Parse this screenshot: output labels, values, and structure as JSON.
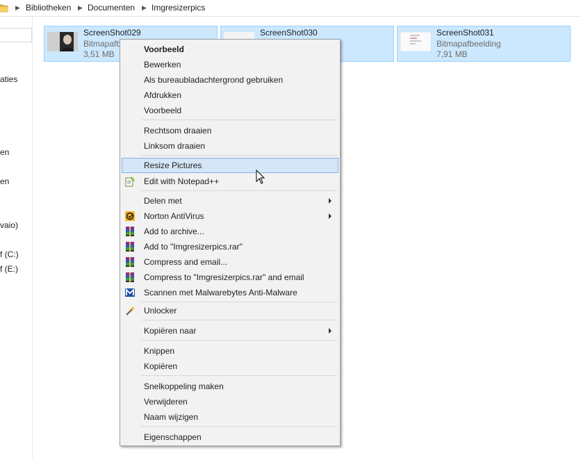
{
  "breadcrumb": {
    "items": [
      "Bibliotheken",
      "Documenten",
      "Imgresizerpics"
    ]
  },
  "navpane": {
    "items": [
      "aties",
      "en",
      "en",
      "vaio)",
      "f (C:)",
      "f (E:)"
    ]
  },
  "files": [
    {
      "name": "ScreenShot029",
      "type": "Bitmapafb",
      "size": "3,51 MB"
    },
    {
      "name": "ScreenShot030",
      "type": "",
      "size": ""
    },
    {
      "name": "ScreenShot031",
      "type": "Bitmapafbeelding",
      "size": "7,91 MB"
    }
  ],
  "context_menu": {
    "items": [
      {
        "label": "Voorbeeld",
        "bold": true
      },
      {
        "label": "Bewerken"
      },
      {
        "label": "Als bureaubladachtergrond gebruiken"
      },
      {
        "label": "Afdrukken"
      },
      {
        "label": "Voorbeeld"
      },
      {
        "label": "Rechtsom draaien"
      },
      {
        "label": "Linksom draaien"
      },
      {
        "label": "Resize Pictures",
        "highlighted": true
      },
      {
        "label": "Edit with Notepad++",
        "icon": "notepad-plus-plus-icon"
      },
      {
        "label": "Delen met",
        "submenu": true
      },
      {
        "label": "Norton AntiVirus",
        "icon": "norton-antivirus-icon",
        "submenu": true
      },
      {
        "label": "Add to archive...",
        "icon": "winrar-icon"
      },
      {
        "label": "Add to \"Imgresizerpics.rar\"",
        "icon": "winrar-icon"
      },
      {
        "label": "Compress and email...",
        "icon": "winrar-icon"
      },
      {
        "label": "Compress to \"Imgresizerpics.rar\" and email",
        "icon": "winrar-icon"
      },
      {
        "label": "Scannen met Malwarebytes Anti-Malware",
        "icon": "malwarebytes-icon"
      },
      {
        "label": "Unlocker",
        "icon": "unlocker-wand-icon"
      },
      {
        "label": "Kopiëren naar",
        "submenu": true
      },
      {
        "label": "Knippen"
      },
      {
        "label": "Kopiëren"
      },
      {
        "label": "Snelkoppeling maken"
      },
      {
        "label": "Verwijderen"
      },
      {
        "label": "Naam wijzigen"
      },
      {
        "label": "Eigenschappen"
      }
    ]
  },
  "colors": {
    "selection_fill": "#cce8ff",
    "selection_border": "#99d1ff",
    "menu_background": "#f2f2f2",
    "menu_highlight": "#d5e6f7"
  }
}
